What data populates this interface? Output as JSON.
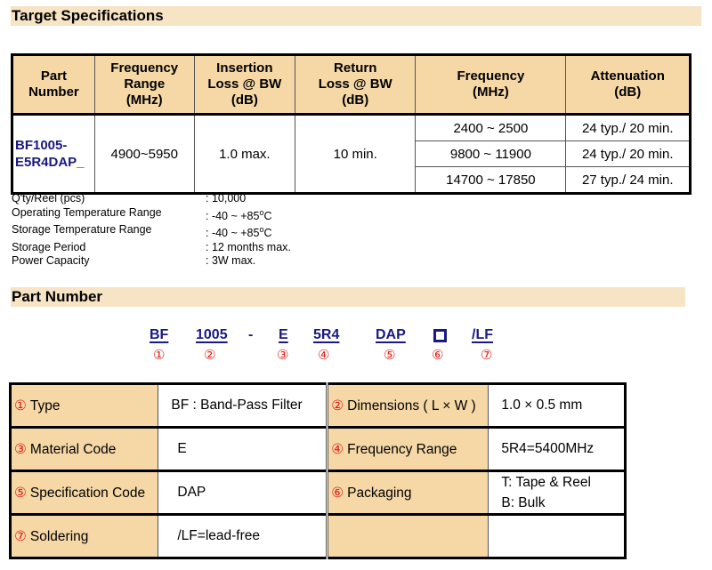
{
  "sections": {
    "target_spec_title": "Target Specifications",
    "part_number_title": "Part Number"
  },
  "spec_table": {
    "headers": {
      "part_number": [
        "Part",
        "Number"
      ],
      "frequency_range": [
        "Frequency",
        "Range",
        "(MHz)"
      ],
      "insertion_loss": [
        "Insertion",
        "Loss @ BW",
        "(dB)"
      ],
      "return_loss": [
        "Return",
        "Loss @ BW",
        "(dB)"
      ],
      "frequency": [
        "Frequency",
        "(MHz)"
      ],
      "attenuation": [
        "Attenuation",
        "(dB)"
      ]
    },
    "part_number": [
      "BF1005-",
      "E5R4DAP_"
    ],
    "frequency_range": "4900~5950",
    "insertion_loss": "1.0 max.",
    "return_loss": "10 min.",
    "attenuation_rows": [
      {
        "frequency": "2400 ~ 2500",
        "attenuation": "24 typ./ 20 min."
      },
      {
        "frequency": "9800 ~ 11900",
        "attenuation": "24 typ./ 20 min."
      },
      {
        "frequency": "14700 ~ 17850",
        "attenuation": "27 typ./ 24 min."
      }
    ]
  },
  "specs": [
    {
      "label": "Q'ty/Reel (pcs)",
      "value": ": 10,000"
    },
    {
      "label": "Operating Temperature Range",
      "value": ": -40 ~ +85",
      "unit": "o",
      "suffix": "C"
    },
    {
      "label": "Storage Temperature Range",
      "value": ": -40 ~ +85",
      "unit": "o",
      "suffix": "C"
    },
    {
      "label": "Storage Period",
      "value": ": 12 months max."
    },
    {
      "label": "Power Capacity",
      "value": ": 3W max."
    }
  ],
  "part_code": {
    "segments": [
      "BF",
      "1005",
      "-",
      "E",
      "5R4",
      "DAP",
      "",
      "/LF"
    ],
    "numbers": [
      "①",
      "②",
      "③",
      "④",
      "⑤",
      "⑥",
      "⑦"
    ]
  },
  "code_table": [
    {
      "n1": "①",
      "k1": "Type",
      "v1": "BF : Band-Pass Filter",
      "n2": "②",
      "k2": "Dimensions ( L × W )",
      "v2": "1.0 × 0.5 mm"
    },
    {
      "n1": "③",
      "k1": "Material Code",
      "v1": "E",
      "n2": "④",
      "k2": "Frequency Range",
      "v2": "5R4=5400MHz"
    },
    {
      "n1": "⑤",
      "k1": "Specification Code",
      "v1": "DAP",
      "n2": "⑥",
      "k2": "Packaging",
      "v2a": "T: Tape & Reel",
      "v2b": "B: Bulk"
    },
    {
      "n1": "⑦",
      "k1": "Soldering",
      "v1": "/LF=lead-free",
      "n2": "",
      "k2": "",
      "v2": ""
    }
  ],
  "colors": {
    "header_bg": "#f5d8a6",
    "section_bg": "#f6e4c4",
    "part_blue": "#1a1a80",
    "number_red": "#e0201a"
  }
}
